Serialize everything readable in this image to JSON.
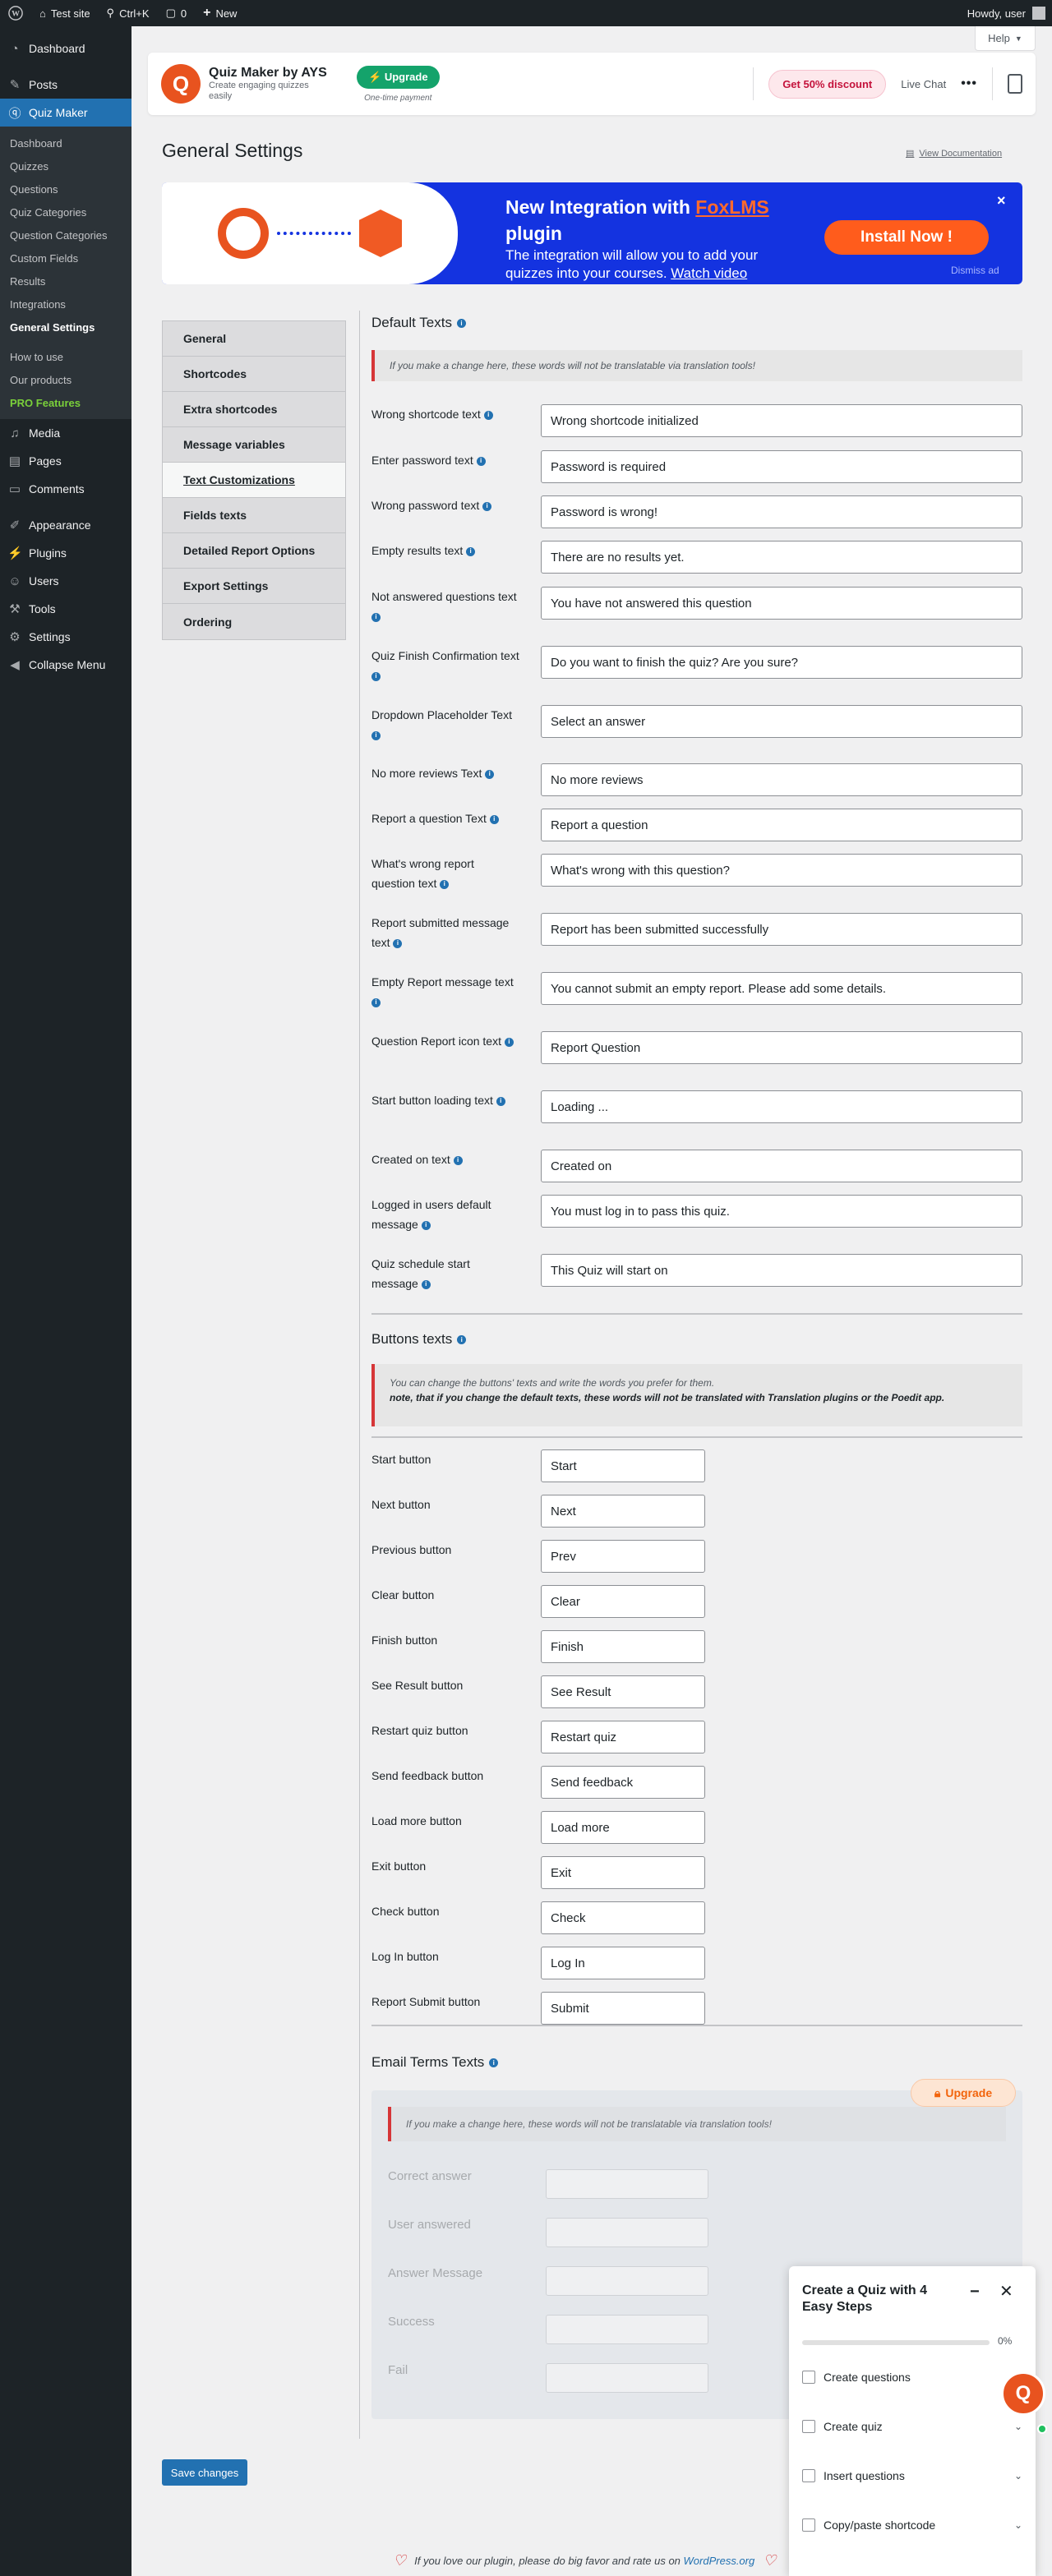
{
  "adminbar": {
    "site": "Test site",
    "shortcut": "Ctrl+K",
    "comments": "0",
    "new": "New",
    "howdy": "Howdy, user"
  },
  "sidebar": {
    "dashboard": "Dashboard",
    "posts": "Posts",
    "quiz_maker": "Quiz Maker",
    "sub": [
      "Dashboard",
      "Quizzes",
      "Questions",
      "Quiz Categories",
      "Question Categories",
      "Custom Fields",
      "Results",
      "Integrations",
      "General Settings",
      "How to use",
      "Our products",
      "PRO Features"
    ],
    "media": "Media",
    "pages": "Pages",
    "comments": "Comments",
    "appearance": "Appearance",
    "plugins": "Plugins",
    "users": "Users",
    "tools": "Tools",
    "settings": "Settings",
    "collapse": "Collapse Menu"
  },
  "help": "Help",
  "header": {
    "title": "Quiz Maker by AYS",
    "subtitle": "Create engaging quizzes easily",
    "upgrade": "Upgrade",
    "one_time": "One-time payment",
    "discount": "Get 50% discount",
    "live_chat": "Live Chat",
    "more": "•••"
  },
  "page": {
    "title": "General Settings",
    "view_doc": "View Documentation"
  },
  "banner": {
    "title_prefix": "New Integration with ",
    "title_brand": "FoxLMS",
    "title_suffix": " plugin",
    "desc": "The integration will allow you to add your quizzes into your courses. ",
    "desc_link": "Watch video",
    "install": "Install Now !",
    "close": "×",
    "dismiss": "Dismiss ad"
  },
  "tabs": [
    "General",
    "Shortcodes",
    "Extra shortcodes",
    "Message variables",
    "Text Customizations",
    "Fields texts",
    "Detailed Report Options",
    "Export Settings",
    "Ordering"
  ],
  "default_texts": {
    "title": "Default Texts",
    "notice": "If you make a change here, these words will not be translatable via translation tools!",
    "rows": [
      {
        "label": "Wrong shortcode text",
        "value": "Wrong shortcode initialized"
      },
      {
        "label": "Enter password text",
        "value": "Password is required"
      },
      {
        "label": "Wrong password text",
        "value": "Password is wrong!"
      },
      {
        "label": "Empty results text",
        "value": "There are no results yet."
      },
      {
        "label": "Not answered questions text",
        "value": "You have not answered this question"
      },
      {
        "label": "Quiz Finish Confirmation text",
        "value": "Do you want to finish the quiz? Are you sure?"
      },
      {
        "label": "Dropdown Placeholder Text",
        "value": "Select an answer"
      },
      {
        "label": "No more reviews Text",
        "value": "No more reviews"
      },
      {
        "label": "Report a question Text",
        "value": "Report a question"
      },
      {
        "label": "What's wrong report question text",
        "value": "What's wrong with this question?"
      },
      {
        "label": "Report submitted message text",
        "value": "Report has been submitted successfully"
      },
      {
        "label": "Empty Report message text",
        "value": "You cannot submit an empty report. Please add some details."
      },
      {
        "label": "Question Report icon text",
        "value": "Report Question"
      },
      {
        "label": "Start button loading text",
        "value": "Loading ..."
      },
      {
        "label": "Created on text",
        "value": "Created on"
      },
      {
        "label": "Logged in users default message",
        "value": "You must log in to pass this quiz."
      },
      {
        "label": "Quiz schedule start message",
        "value": "This Quiz will start on"
      }
    ]
  },
  "buttons_texts": {
    "title": "Buttons texts",
    "notice_line1": "You can change the buttons' texts and write the words you prefer for them.",
    "notice_line2": "note, that if you change the default texts, these words will not be translated with Translation plugins or the Poedit app.",
    "rows": [
      {
        "label": "Start button",
        "value": "Start"
      },
      {
        "label": "Next button",
        "value": "Next"
      },
      {
        "label": "Previous button",
        "value": "Prev"
      },
      {
        "label": "Clear button",
        "value": "Clear"
      },
      {
        "label": "Finish button",
        "value": "Finish"
      },
      {
        "label": "See Result button",
        "value": "See Result"
      },
      {
        "label": "Restart quiz button",
        "value": "Restart quiz"
      },
      {
        "label": "Send feedback button",
        "value": "Send feedback"
      },
      {
        "label": "Load more button",
        "value": "Load more"
      },
      {
        "label": "Exit button",
        "value": "Exit"
      },
      {
        "label": "Check button",
        "value": "Check"
      },
      {
        "label": "Log In button",
        "value": "Log In"
      },
      {
        "label": "Report Submit button",
        "value": "Submit"
      }
    ]
  },
  "email_terms": {
    "title": "Email Terms Texts",
    "upgrade": "Upgrade",
    "notice": "If you make a change here, these words will not be translatable via translation tools!",
    "rows": [
      "Correct answer",
      "User answered",
      "Answer Message",
      "Success",
      "Fail"
    ]
  },
  "save": "Save changes",
  "footer": {
    "text": "If you love our plugin, please do big favor and rate us on ",
    "link": "WordPress.org"
  },
  "steps": {
    "title": "Create a Quiz with 4 Easy Steps",
    "progress": "0%",
    "items": [
      "Create questions",
      "Create quiz",
      "Insert questions",
      "Copy/paste shortcode"
    ]
  }
}
